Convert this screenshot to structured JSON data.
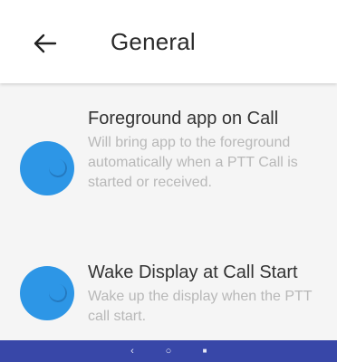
{
  "header": {
    "title": "General",
    "back_icon": "arrow-left-icon"
  },
  "settings": [
    {
      "title": "Foreground app on Call",
      "description": "Will bring app to the foreground automatically when a PTT Call is started or received.",
      "toggle_color": "#2d96e6"
    },
    {
      "title": "Wake Display at Call Start",
      "description": "Wake up the display when the PTT call start.",
      "toggle_color": "#2d96e6"
    }
  ],
  "nav_bar": {
    "color": "#3847a8",
    "back_glyph": "‹",
    "home_glyph": "○",
    "recents_glyph": "■"
  }
}
